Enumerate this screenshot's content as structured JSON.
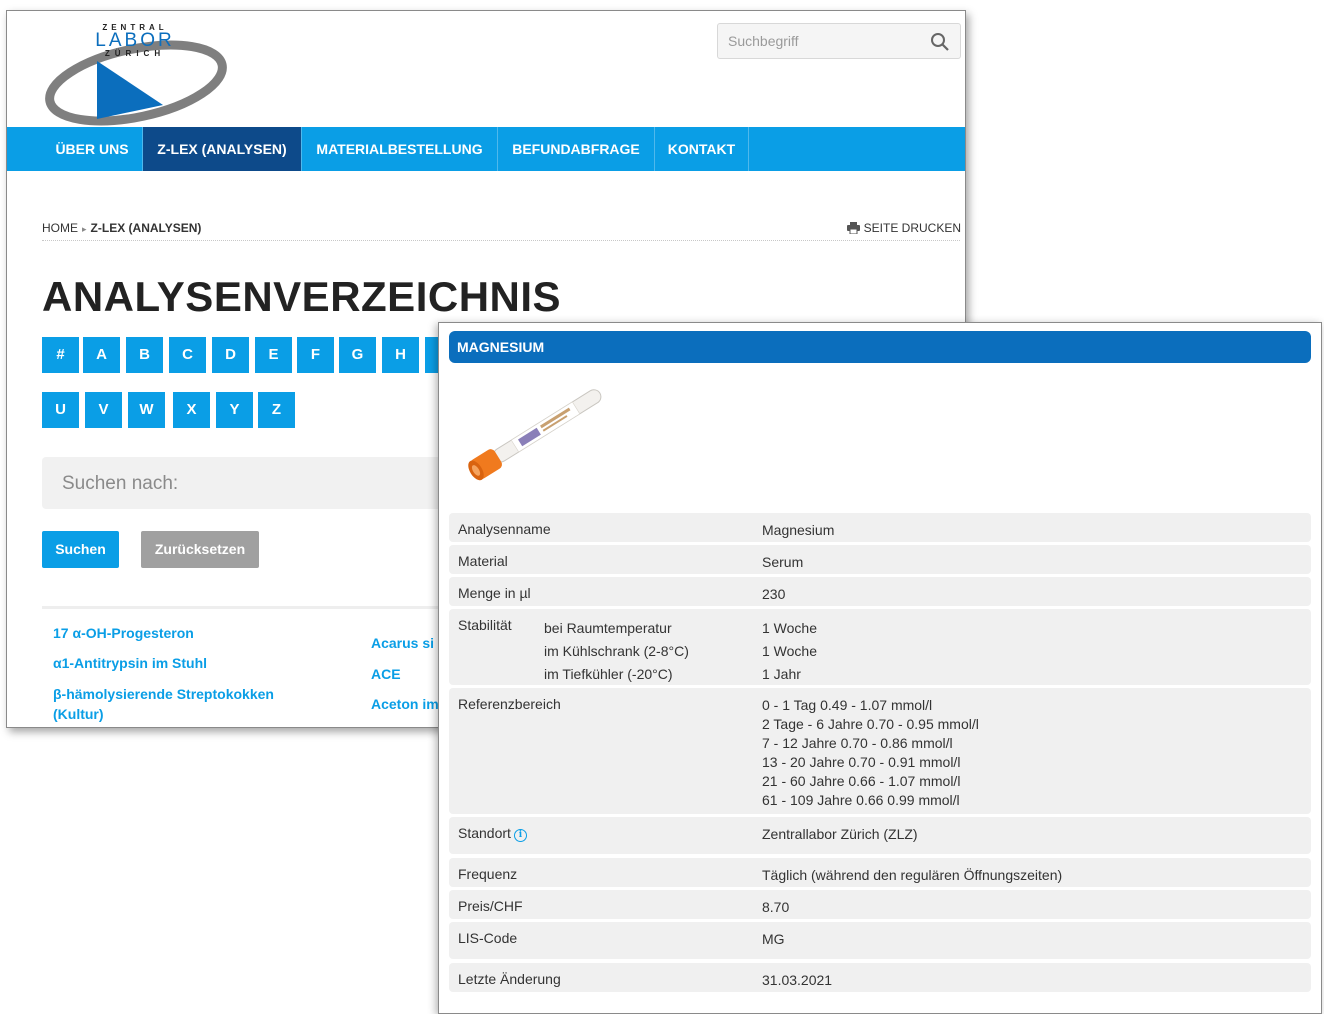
{
  "logo": {
    "line1": "ZENTRAL",
    "line2": "LABOR",
    "line3": "ZÜRICH"
  },
  "search": {
    "placeholder": "Suchbegriff",
    "icon": "search-icon"
  },
  "nav": {
    "items": [
      "ÜBER UNS",
      "Z-LEX (ANALYSEN)",
      "MATERIALBESTELLUNG",
      "BEFUNDABFRAGE",
      "KONTAKT"
    ],
    "active_index": 1,
    "color": "#0a9ee6",
    "active_color": "#0d4a8a"
  },
  "breadcrumb": {
    "home": "HOME",
    "separator": "▸",
    "current": "Z-LEX (ANALYSEN)"
  },
  "print": {
    "label": "SEITE DRUCKEN",
    "icon": "printer-icon"
  },
  "page_title": "ANALYSENVERZEICHNIS",
  "letters_row1": [
    "#",
    "A",
    "B",
    "C",
    "D",
    "E",
    "F",
    "G",
    "H"
  ],
  "letters_row2": [
    "U",
    "V",
    "W",
    "X",
    "Y",
    "Z"
  ],
  "filter": {
    "placeholder": "Suchen nach:",
    "search_button": "Suchen",
    "reset_button": "Zurücksetzen"
  },
  "analyses_col1": [
    "17 α-OH-Progesteron",
    "α1-Antitrypsin im Stuhl",
    "β-hämolysierende Streptokokken (Kultur)"
  ],
  "analyses_col2": [
    "Acarus si",
    "ACE",
    "Aceton im"
  ],
  "detail": {
    "title": "MAGNESIUM",
    "rows": {
      "name": {
        "label": "Analysenname",
        "value": "Magnesium"
      },
      "material": {
        "label": "Material",
        "value": "Serum"
      },
      "menge": {
        "label": "Menge in µl",
        "value": "230"
      },
      "stabilitaet": {
        "label": "Stabilität",
        "conditions": [
          "bei Raumtemperatur",
          "im Kühlschrank (2-8°C)",
          "im Tiefkühler (-20°C)"
        ],
        "values": [
          "1 Woche",
          "1 Woche",
          "1 Jahr"
        ]
      },
      "referenz": {
        "label": "Referenzbereich",
        "values": [
          "0 - 1 Tag 0.49 - 1.07 mmol/l",
          "2 Tage - 6 Jahre 0.70 - 0.95 mmol/l",
          "7 - 12 Jahre 0.70 - 0.86 mmol/l",
          "13 - 20 Jahre 0.70 - 0.91 mmol/l",
          "21 - 60 Jahre 0.66 - 1.07 mmol/l",
          "61 - 109 Jahre 0.66 0.99 mmol/l"
        ]
      },
      "standort": {
        "label": "Standort",
        "value": "Zentrallabor Zürich (ZLZ)",
        "icon": "info-icon"
      },
      "frequenz": {
        "label": "Frequenz",
        "value": "Täglich (während den regulären Öffnungszeiten)"
      },
      "preis": {
        "label": "Preis/CHF",
        "value": "8.70"
      },
      "lis": {
        "label": "LIS-Code",
        "value": "MG"
      },
      "aenderung": {
        "label": "Letzte Änderung",
        "value": "31.03.2021"
      }
    }
  }
}
